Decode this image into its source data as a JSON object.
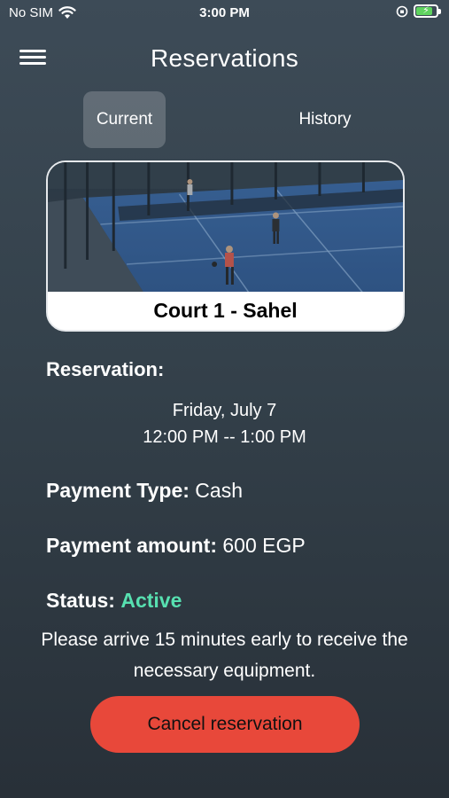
{
  "status_bar": {
    "carrier": "No SIM",
    "time": "3:00 PM",
    "battery_color": "#5fd35f"
  },
  "header": {
    "title": "Reservations",
    "menu_icon": "hamburger-menu-icon"
  },
  "tabs": [
    {
      "label": "Current",
      "selected": true
    },
    {
      "label": "History",
      "selected": false
    }
  ],
  "court": {
    "name": "Court 1 - Sahel"
  },
  "reservation": {
    "heading": "Reservation:",
    "date": "Friday, July 7",
    "time": "12:00 PM -- 1:00 PM"
  },
  "payment": {
    "type_label": "Payment Type:",
    "type_value": "Cash",
    "amount_label": "Payment amount:",
    "amount_value": "600 EGP"
  },
  "status": {
    "label": "Status:",
    "value": "Active",
    "color": "#57e0b0"
  },
  "note": "Please arrive 15 minutes early to receive the necessary equipment.",
  "actions": {
    "cancel_label": "Cancel reservation",
    "cancel_color": "#e8483a"
  }
}
